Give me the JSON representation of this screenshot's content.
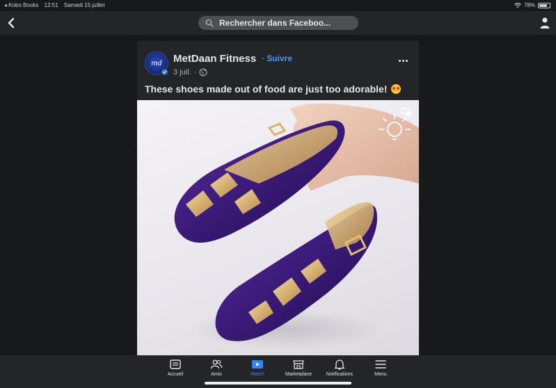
{
  "status_bar": {
    "back_app": "◂ Kobo Books",
    "time": "12:51",
    "date": "Samedi 15 juillet",
    "battery": "78%",
    "battery_level": 0.78
  },
  "top_bar": {
    "search_placeholder": "Rechercher dans Faceboo..."
  },
  "post": {
    "page_name": "MetDaan Fitness",
    "follow_label": "· Suivre",
    "date": "3 juil.",
    "separator": "·",
    "caption": "These shoes made out of food are just too adorable!",
    "avatar_text": "md"
  },
  "tabs": [
    {
      "label": "Accueil",
      "icon": "home-feed-icon",
      "active": false
    },
    {
      "label": "Amis",
      "icon": "friends-icon",
      "active": false
    },
    {
      "label": "Watch",
      "icon": "watch-icon",
      "active": true
    },
    {
      "label": "Marketplace",
      "icon": "marketplace-icon",
      "active": false
    },
    {
      "label": "Notifications",
      "icon": "bell-icon",
      "active": false
    },
    {
      "label": "Menu",
      "icon": "menu-icon",
      "active": false
    }
  ],
  "colors": {
    "background": "#18191a",
    "surface": "#242526",
    "accent": "#2d88ff",
    "link": "#4599ff"
  }
}
